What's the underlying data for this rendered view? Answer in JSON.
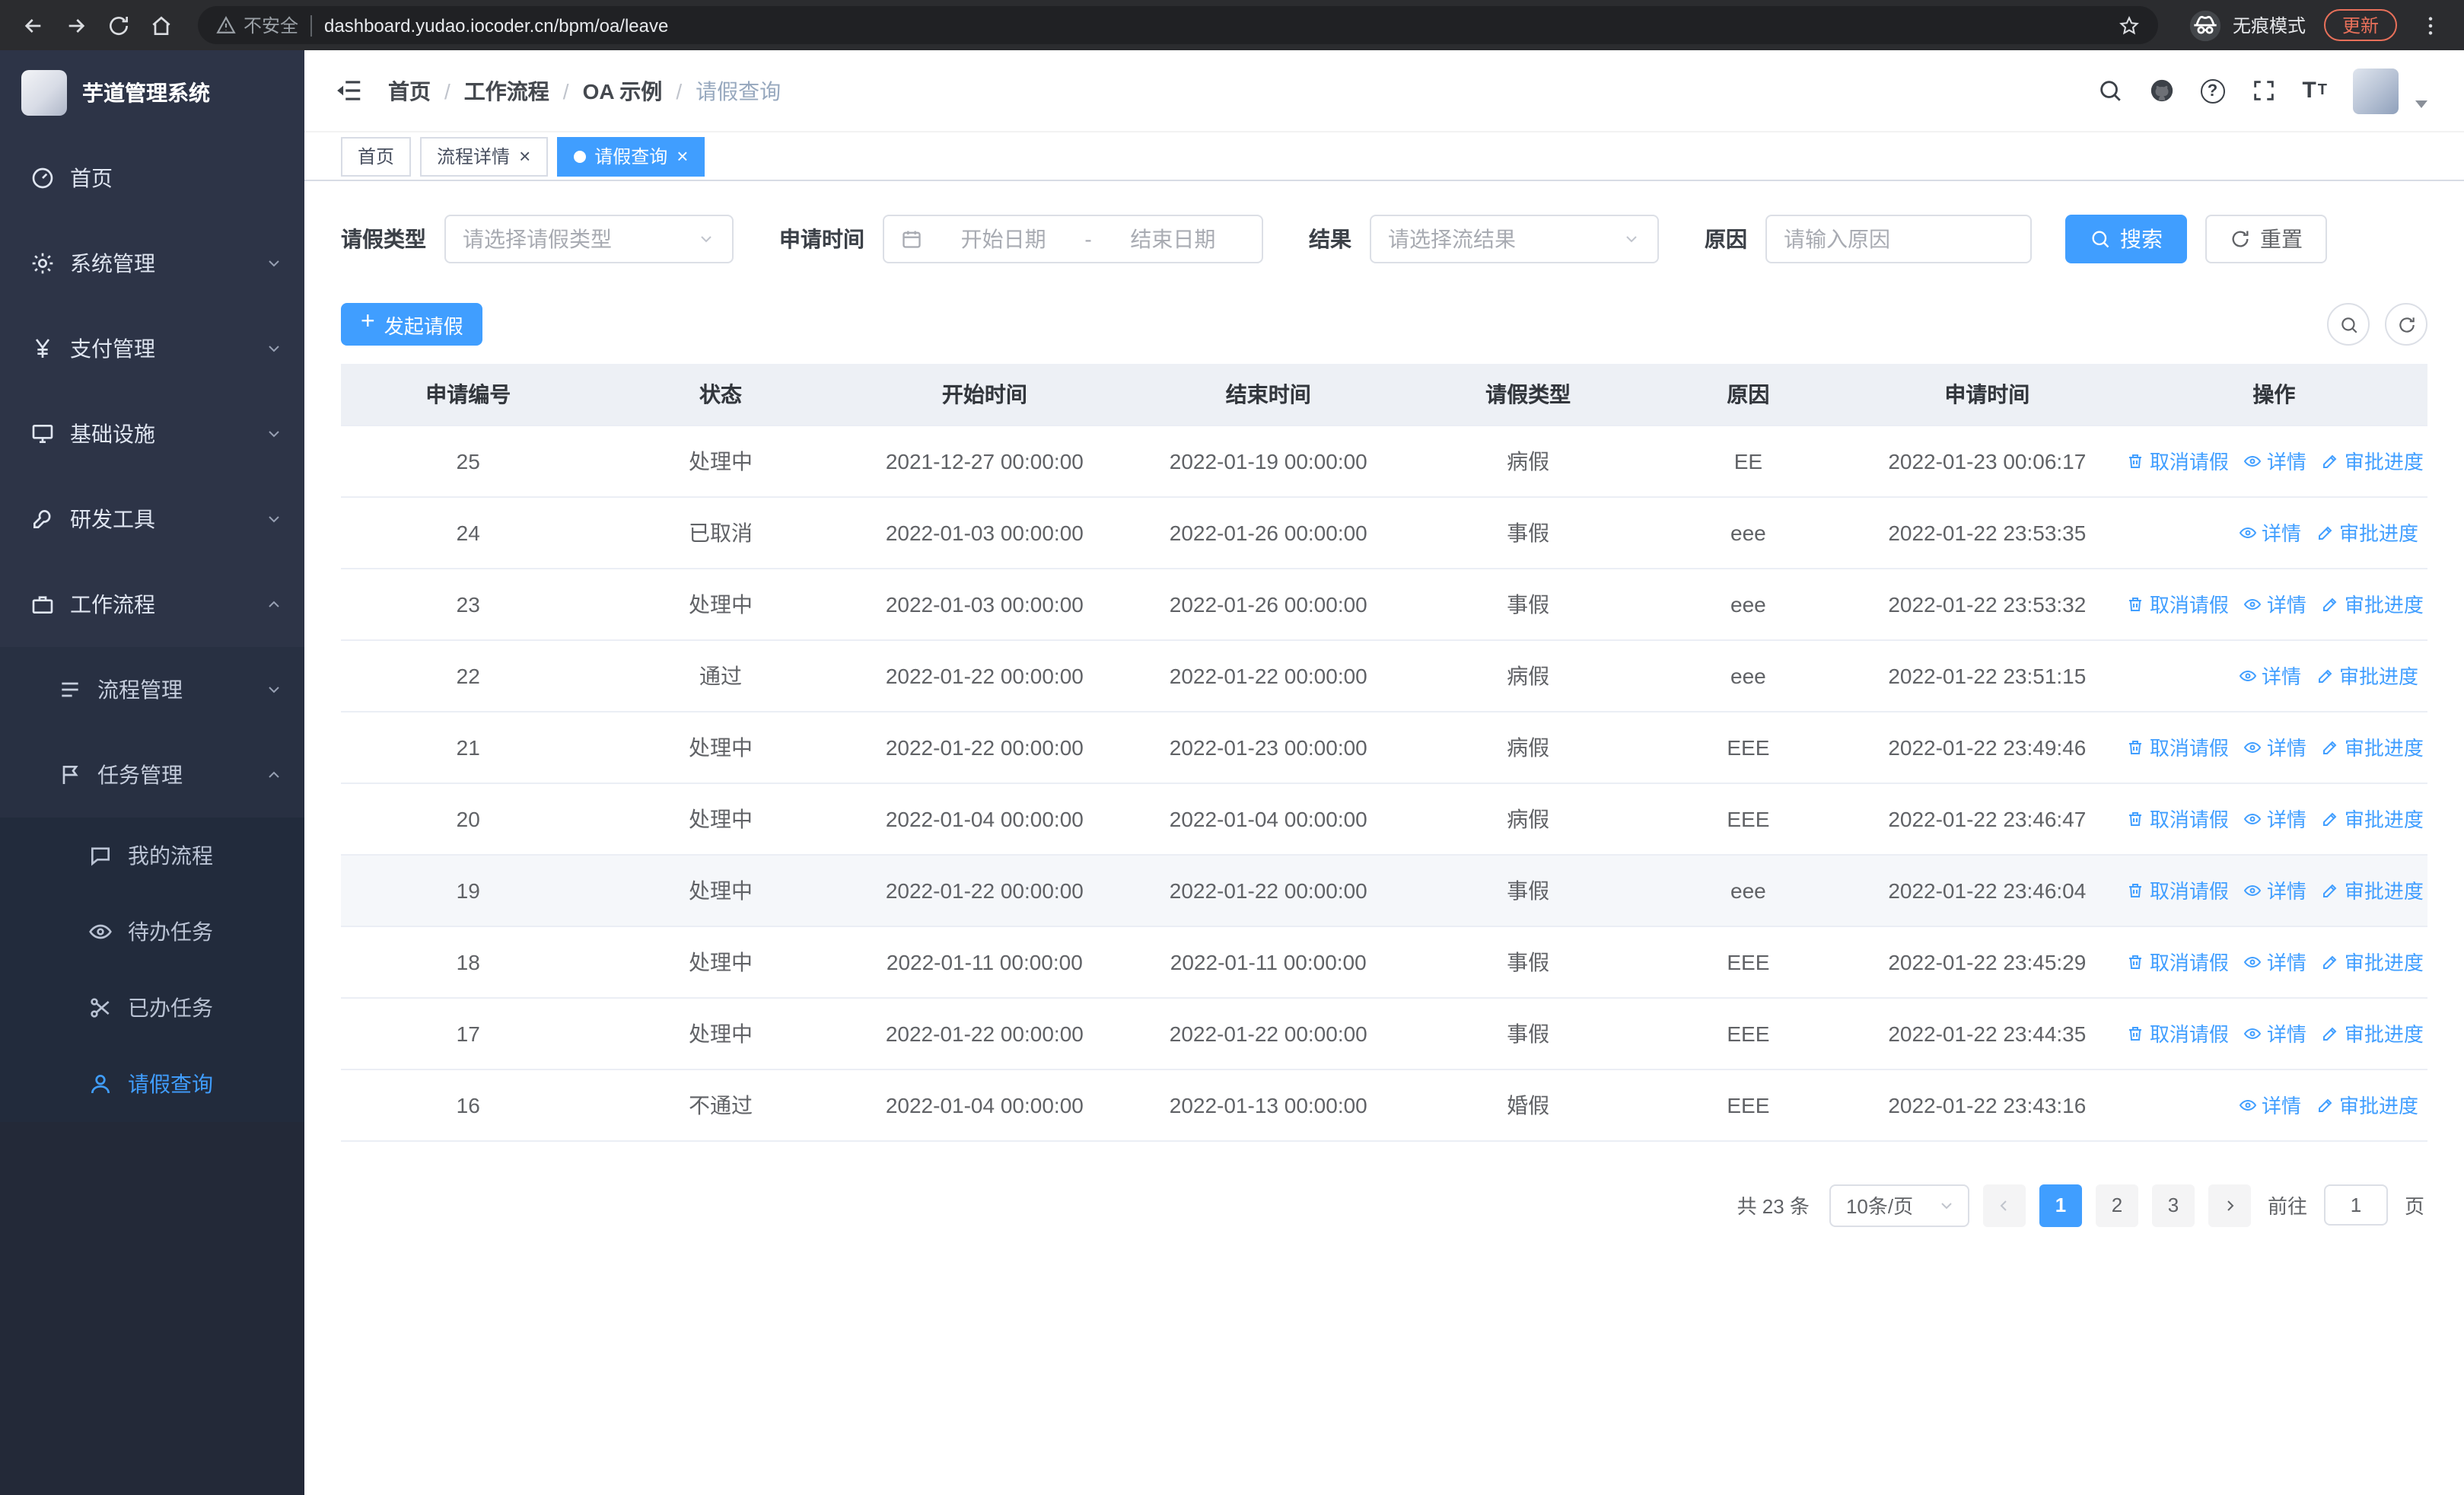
{
  "browser": {
    "security_label": "不安全",
    "url": "dashboard.yudao.iocoder.cn/bpm/oa/leave",
    "incognito_label": "无痕模式",
    "update_label": "更新"
  },
  "sidebar": {
    "app_title": "芋道管理系统",
    "menu": [
      {
        "key": "home",
        "label": "首页",
        "icon": "dashboard-icon",
        "level": 1
      },
      {
        "key": "system",
        "label": "系统管理",
        "icon": "gear-icon",
        "level": 1,
        "chevron": "down"
      },
      {
        "key": "payment",
        "label": "支付管理",
        "icon": "yen-icon",
        "level": 1,
        "chevron": "down"
      },
      {
        "key": "infrastructure",
        "label": "基础设施",
        "icon": "infrastructure-icon",
        "level": 1,
        "chevron": "down"
      },
      {
        "key": "devtools",
        "label": "研发工具",
        "icon": "tools-icon",
        "level": 1,
        "chevron": "down"
      },
      {
        "key": "workflow",
        "label": "工作流程",
        "icon": "workflow-icon",
        "level": 1,
        "chevron": "up"
      },
      {
        "key": "process-mgmt",
        "label": "流程管理",
        "icon": "process-icon",
        "level": 2,
        "chevron": "down"
      },
      {
        "key": "task-mgmt",
        "label": "任务管理",
        "icon": "task-icon",
        "level": 2,
        "chevron": "up"
      },
      {
        "key": "my-process",
        "label": "我的流程",
        "icon": "chat-icon",
        "level": 3
      },
      {
        "key": "todo-tasks",
        "label": "待办任务",
        "icon": "eye-icon",
        "level": 3
      },
      {
        "key": "done-tasks",
        "label": "已办任务",
        "icon": "scissors-icon",
        "level": 3
      },
      {
        "key": "leave-query",
        "label": "请假查询",
        "icon": "user-icon",
        "level": 3,
        "active": true
      }
    ]
  },
  "header": {
    "breadcrumb": [
      "首页",
      "工作流程",
      "OA 示例",
      "请假查询"
    ]
  },
  "tabs": [
    {
      "key": "home",
      "label": "首页"
    },
    {
      "key": "process-detail",
      "label": "流程详情",
      "closable": true
    },
    {
      "key": "leave-query",
      "label": "请假查询",
      "active": true,
      "closable": true
    }
  ],
  "filters": {
    "leave_type_label": "请假类型",
    "leave_type_placeholder": "请选择请假类型",
    "apply_time_label": "申请时间",
    "start_date_placeholder": "开始日期",
    "range_separator": "-",
    "end_date_placeholder": "结束日期",
    "result_label": "结果",
    "result_placeholder": "请选择流结果",
    "reason_label": "原因",
    "reason_placeholder": "请输入原因",
    "search_label": "搜索",
    "reset_label": "重置"
  },
  "toolbar": {
    "create_label": "发起请假"
  },
  "table": {
    "columns": [
      "申请编号",
      "状态",
      "开始时间",
      "结束时间",
      "请假类型",
      "原因",
      "申请时间",
      "操作"
    ],
    "action_labels": {
      "cancel": "取消请假",
      "detail": "详情",
      "progress": "审批进度"
    },
    "rows": [
      {
        "id": "25",
        "status": "处理中",
        "start": "2021-12-27 00:00:00",
        "end": "2022-01-19 00:00:00",
        "type": "病假",
        "reason": "EE",
        "applied": "2022-01-23 00:06:17",
        "can_cancel": true
      },
      {
        "id": "24",
        "status": "已取消",
        "start": "2022-01-03 00:00:00",
        "end": "2022-01-26 00:00:00",
        "type": "事假",
        "reason": "eee",
        "applied": "2022-01-22 23:53:35",
        "can_cancel": false
      },
      {
        "id": "23",
        "status": "处理中",
        "start": "2022-01-03 00:00:00",
        "end": "2022-01-26 00:00:00",
        "type": "事假",
        "reason": "eee",
        "applied": "2022-01-22 23:53:32",
        "can_cancel": true
      },
      {
        "id": "22",
        "status": "通过",
        "start": "2022-01-22 00:00:00",
        "end": "2022-01-22 00:00:00",
        "type": "病假",
        "reason": "eee",
        "applied": "2022-01-22 23:51:15",
        "can_cancel": false
      },
      {
        "id": "21",
        "status": "处理中",
        "start": "2022-01-22 00:00:00",
        "end": "2022-01-23 00:00:00",
        "type": "病假",
        "reason": "EEE",
        "applied": "2022-01-22 23:49:46",
        "can_cancel": true
      },
      {
        "id": "20",
        "status": "处理中",
        "start": "2022-01-04 00:00:00",
        "end": "2022-01-04 00:00:00",
        "type": "病假",
        "reason": "EEE",
        "applied": "2022-01-22 23:46:47",
        "can_cancel": true
      },
      {
        "id": "19",
        "status": "处理中",
        "start": "2022-01-22 00:00:00",
        "end": "2022-01-22 00:00:00",
        "type": "事假",
        "reason": "eee",
        "applied": "2022-01-22 23:46:04",
        "can_cancel": true,
        "hover": true
      },
      {
        "id": "18",
        "status": "处理中",
        "start": "2022-01-11 00:00:00",
        "end": "2022-01-11 00:00:00",
        "type": "事假",
        "reason": "EEE",
        "applied": "2022-01-22 23:45:29",
        "can_cancel": true
      },
      {
        "id": "17",
        "status": "处理中",
        "start": "2022-01-22 00:00:00",
        "end": "2022-01-22 00:00:00",
        "type": "事假",
        "reason": "EEE",
        "applied": "2022-01-22 23:44:35",
        "can_cancel": true
      },
      {
        "id": "16",
        "status": "不通过",
        "start": "2022-01-04 00:00:00",
        "end": "2022-01-13 00:00:00",
        "type": "婚假",
        "reason": "EEE",
        "applied": "2022-01-22 23:43:16",
        "can_cancel": false
      }
    ]
  },
  "pagination": {
    "total_label": "共 23 条",
    "page_size_label": "10条/页",
    "pages": [
      "1",
      "2",
      "3"
    ],
    "current_page": "1",
    "goto_label": "前往",
    "goto_value": "1",
    "goto_suffix": "页"
  },
  "colors": {
    "primary": "#409eff",
    "sidebar_bg": "#2d3447",
    "header_row_bg": "#edf0f5"
  }
}
